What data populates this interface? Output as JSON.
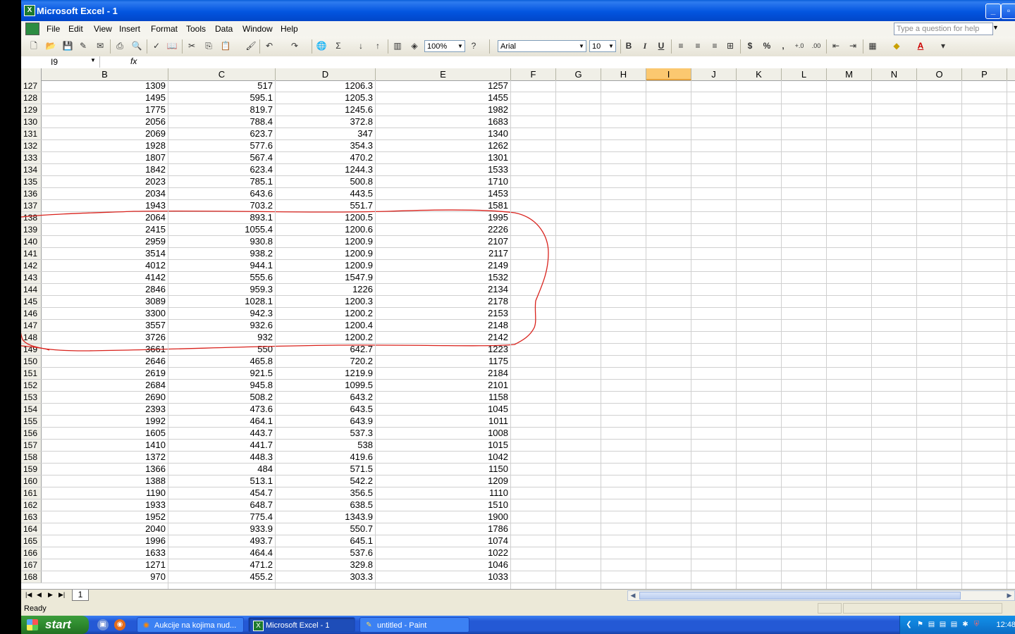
{
  "window": {
    "title": "Microsoft Excel - 1"
  },
  "menu": [
    "File",
    "Edit",
    "View",
    "Insert",
    "Format",
    "Tools",
    "Data",
    "Window",
    "Help"
  ],
  "help_placeholder": "Type a question for help",
  "toolbar": {
    "zoom": "100%",
    "font": "Arial",
    "font_size": "10",
    "bold": "B",
    "italic": "I",
    "underline": "U",
    "currency": "$",
    "percent": "%",
    "comma": ","
  },
  "formula_bar": {
    "name_box": "I9",
    "fx": "fx"
  },
  "columns": [
    "B",
    "C",
    "D",
    "E",
    "F",
    "G",
    "H",
    "I",
    "J",
    "K",
    "L",
    "M",
    "N",
    "O",
    "P"
  ],
  "selected_column": "I",
  "rows": [
    [
      "127",
      "1309",
      "517",
      "1206.3",
      "1257"
    ],
    [
      "128",
      "1495",
      "595.1",
      "1205.3",
      "1455"
    ],
    [
      "129",
      "1775",
      "819.7",
      "1245.6",
      "1982"
    ],
    [
      "130",
      "2056",
      "788.4",
      "372.8",
      "1683"
    ],
    [
      "131",
      "2069",
      "623.7",
      "347",
      "1340"
    ],
    [
      "132",
      "1928",
      "577.6",
      "354.3",
      "1262"
    ],
    [
      "133",
      "1807",
      "567.4",
      "470.2",
      "1301"
    ],
    [
      "134",
      "1842",
      "623.4",
      "1244.3",
      "1533"
    ],
    [
      "135",
      "2023",
      "785.1",
      "500.8",
      "1710"
    ],
    [
      "136",
      "2034",
      "643.6",
      "443.5",
      "1453"
    ],
    [
      "137",
      "1943",
      "703.2",
      "551.7",
      "1581"
    ],
    [
      "138",
      "2064",
      "893.1",
      "1200.5",
      "1995"
    ],
    [
      "139",
      "2415",
      "1055.4",
      "1200.6",
      "2226"
    ],
    [
      "140",
      "2959",
      "930.8",
      "1200.9",
      "2107"
    ],
    [
      "141",
      "3514",
      "938.2",
      "1200.9",
      "2117"
    ],
    [
      "142",
      "4012",
      "944.1",
      "1200.9",
      "2149"
    ],
    [
      "143",
      "4142",
      "555.6",
      "1547.9",
      "1532"
    ],
    [
      "144",
      "2846",
      "959.3",
      "1226",
      "2134"
    ],
    [
      "145",
      "3089",
      "1028.1",
      "1200.3",
      "2178"
    ],
    [
      "146",
      "3300",
      "942.3",
      "1200.2",
      "2153"
    ],
    [
      "147",
      "3557",
      "932.6",
      "1200.4",
      "2148"
    ],
    [
      "148",
      "3726",
      "932",
      "1200.2",
      "2142"
    ],
    [
      "149",
      "3661",
      "550",
      "642.7",
      "1223"
    ],
    [
      "150",
      "2646",
      "465.8",
      "720.2",
      "1175"
    ],
    [
      "151",
      "2619",
      "921.5",
      "1219.9",
      "2184"
    ],
    [
      "152",
      "2684",
      "945.8",
      "1099.5",
      "2101"
    ],
    [
      "153",
      "2690",
      "508.2",
      "643.2",
      "1158"
    ],
    [
      "154",
      "2393",
      "473.6",
      "643.5",
      "1045"
    ],
    [
      "155",
      "1992",
      "464.1",
      "643.9",
      "1011"
    ],
    [
      "156",
      "1605",
      "443.7",
      "537.3",
      "1008"
    ],
    [
      "157",
      "1410",
      "441.7",
      "538",
      "1015"
    ],
    [
      "158",
      "1372",
      "448.3",
      "419.6",
      "1042"
    ],
    [
      "159",
      "1366",
      "484",
      "571.5",
      "1150"
    ],
    [
      "160",
      "1388",
      "513.1",
      "542.2",
      "1209"
    ],
    [
      "161",
      "1190",
      "454.7",
      "356.5",
      "1110"
    ],
    [
      "162",
      "1933",
      "648.7",
      "638.5",
      "1510"
    ],
    [
      "163",
      "1952",
      "775.4",
      "1343.9",
      "1900"
    ],
    [
      "164",
      "2040",
      "933.9",
      "550.7",
      "1786"
    ],
    [
      "165",
      "1996",
      "493.7",
      "645.1",
      "1074"
    ],
    [
      "166",
      "1633",
      "464.4",
      "537.6",
      "1022"
    ],
    [
      "167",
      "1271",
      "471.2",
      "329.8",
      "1046"
    ],
    [
      "168",
      "970",
      "455.2",
      "303.3",
      "1033"
    ]
  ],
  "sheet_tab": "1",
  "status": "Ready",
  "taskbar": {
    "start": "start",
    "tasks": [
      "Aukcije na kojima nud...",
      "Microsoft Excel - 1",
      "untitled - Paint"
    ],
    "clock": "12:48"
  }
}
